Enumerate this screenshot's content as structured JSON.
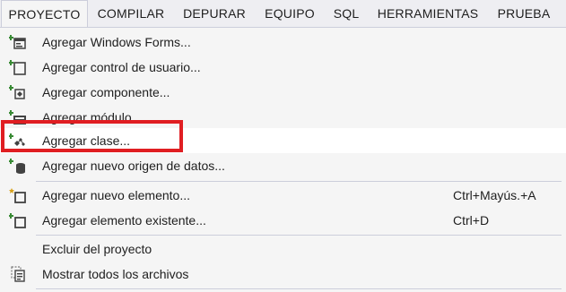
{
  "menubar": {
    "items": [
      "PROYECTO",
      "COMPILAR",
      "DEPURAR",
      "EQUIPO",
      "SQL",
      "HERRAMIENTAS",
      "PRUEBA"
    ]
  },
  "menu": {
    "items": [
      {
        "label": "Agregar Windows Forms...",
        "icon": "windows-form-icon",
        "shortcut": ""
      },
      {
        "label": "Agregar control de usuario...",
        "icon": "user-control-icon",
        "shortcut": ""
      },
      {
        "label": "Agregar componente...",
        "icon": "component-icon",
        "shortcut": ""
      },
      {
        "label": "Agregar módulo...",
        "icon": "module-icon",
        "shortcut": ""
      },
      {
        "label": "Agregar clase...",
        "icon": "class-icon",
        "shortcut": ""
      },
      {
        "label": "Agregar nuevo origen de datos...",
        "icon": "data-source-icon",
        "shortcut": ""
      },
      {
        "label": "Agregar nuevo elemento...",
        "icon": "new-item-icon",
        "shortcut": "Ctrl+Mayús.+A"
      },
      {
        "label": "Agregar elemento existente...",
        "icon": "existing-item-icon",
        "shortcut": "Ctrl+D"
      },
      {
        "label": "Excluir del proyecto",
        "icon": "",
        "shortcut": ""
      },
      {
        "label": "Mostrar todos los archivos",
        "icon": "show-all-files-icon",
        "shortcut": ""
      }
    ]
  },
  "colors": {
    "highlight": "#e01e22",
    "icon_green": "#388a34",
    "icon_dark": "#424242"
  }
}
